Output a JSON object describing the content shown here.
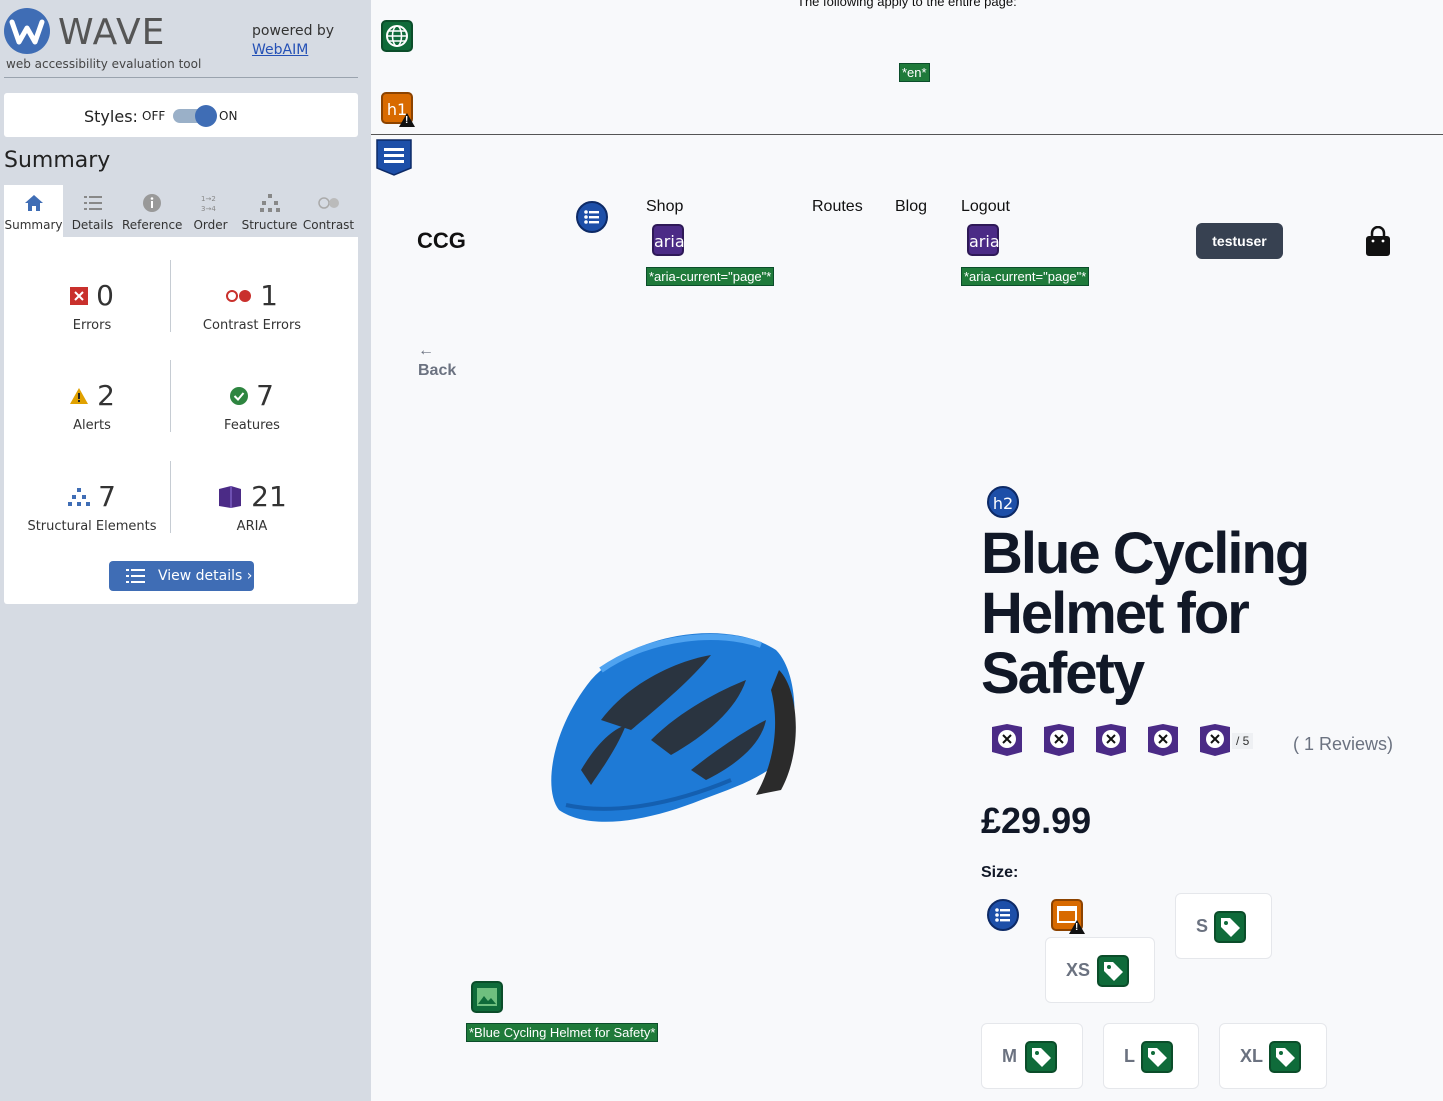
{
  "wave": {
    "title": "WAVE",
    "subtitle": "web accessibility evaluation tool",
    "powered_by": "powered by",
    "webaim_link": "WebAIM",
    "styles": {
      "label": "Styles:",
      "off": "OFF",
      "on": "ON",
      "state": "on"
    },
    "summary_heading": "Summary",
    "tabs": [
      {
        "label": "Summary",
        "icon": "home-icon",
        "active": true
      },
      {
        "label": "Details",
        "icon": "list-icon",
        "active": false
      },
      {
        "label": "Reference",
        "icon": "info-icon",
        "active": false
      },
      {
        "label": "Order",
        "icon": "order-icon",
        "active": false
      },
      {
        "label": "Structure",
        "icon": "structure-icon",
        "active": false
      },
      {
        "label": "Contrast",
        "icon": "contrast-icon",
        "active": false
      }
    ],
    "stats": {
      "errors": {
        "count": "0",
        "label": "Errors"
      },
      "contrast_errors": {
        "count": "1",
        "label": "Contrast Errors"
      },
      "alerts": {
        "count": "2",
        "label": "Alerts"
      },
      "features": {
        "count": "7",
        "label": "Features"
      },
      "structural": {
        "count": "7",
        "label": "Structural Elements"
      },
      "aria": {
        "count": "21",
        "label": "ARIA"
      }
    },
    "view_details": "View details ›",
    "colors": {
      "accent": "#3f6db5",
      "error": "#c9302c",
      "alert": "#e0a100",
      "feature": "#2e8540",
      "aria": "#4b2b86"
    }
  },
  "page": {
    "apply_note": "The following apply to the entire page:",
    "lang_tag": "*en*",
    "wave_icons": {
      "h1": "h1",
      "h2": "h2",
      "aria": "aria"
    },
    "brand": "CCG",
    "nav": {
      "shop": "Shop",
      "routes": "Routes",
      "blog": "Blog",
      "logout": "Logout"
    },
    "aria_current_tag": "*aria-current=\"page\"*",
    "user_button": "testuser",
    "back": {
      "arrow": "←",
      "label": "Back"
    },
    "image_alt_tag": "*Blue Cycling Helmet for Safety*",
    "product": {
      "title": "Blue Cycling Helmet for Safety",
      "rating_max": "/ 5",
      "reviews": "( 1 Reviews)",
      "price": "£29.99",
      "size_label": "Size:",
      "sizes": [
        "S",
        "XS",
        "M",
        "L",
        "XL"
      ]
    }
  }
}
